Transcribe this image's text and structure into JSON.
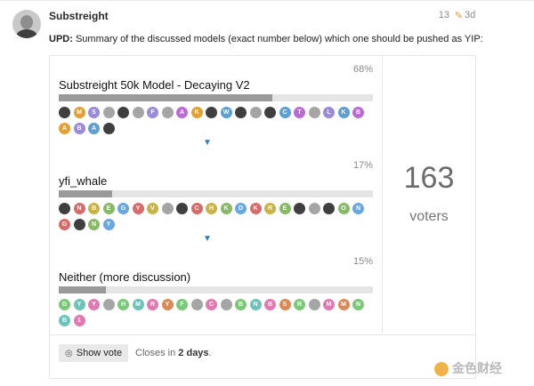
{
  "post": {
    "username": "Substreight",
    "edits": "13",
    "date": "3d",
    "text_prefix": "UPD:",
    "text_body": " Summary of the discussed models (exact number below) which one should be pushed as YIP:"
  },
  "poll": {
    "voters_count": "163",
    "voters_label": "voters",
    "show_vote_label": "Show vote",
    "closes_prefix": "Closes in ",
    "closes_value": "2 days",
    "closes_suffix": ".",
    "options": [
      {
        "label": "Substreight 50k Model - Decaying V2",
        "percent_text": "68%",
        "percent": 68,
        "voters": [
          "",
          "M",
          "S",
          "",
          "",
          "",
          "F",
          "",
          "A",
          "K",
          "",
          "W",
          "",
          "",
          "",
          "C",
          "T",
          "",
          "L",
          "K",
          "B",
          "A",
          "B",
          "A",
          ""
        ]
      },
      {
        "label": "yfi_whale",
        "percent_text": "17%",
        "percent": 17,
        "voters": [
          "",
          "N",
          "B",
          "E",
          "G",
          "Y",
          "V",
          "",
          "",
          "C",
          "H",
          "K",
          "D",
          "K",
          "R",
          "E",
          "",
          "",
          "",
          "O",
          "N",
          "G",
          "",
          "N",
          "Y"
        ]
      },
      {
        "label": "Neither (more discussion)",
        "percent_text": "15%",
        "percent": 15,
        "voters": [
          "G",
          "Y",
          "Y",
          "",
          "H",
          "M",
          "R",
          "Y",
          "F",
          "",
          "C",
          "",
          "B",
          "N",
          "B",
          "S",
          "R",
          "",
          "M",
          "M",
          "N",
          "B",
          "1"
        ]
      }
    ]
  },
  "watermark": {
    "text": "金色财经"
  },
  "colors": {
    "accent": "#2b7fc3",
    "bar_fill": "#9a9a9a",
    "bar_bg": "#e5e5e5"
  }
}
